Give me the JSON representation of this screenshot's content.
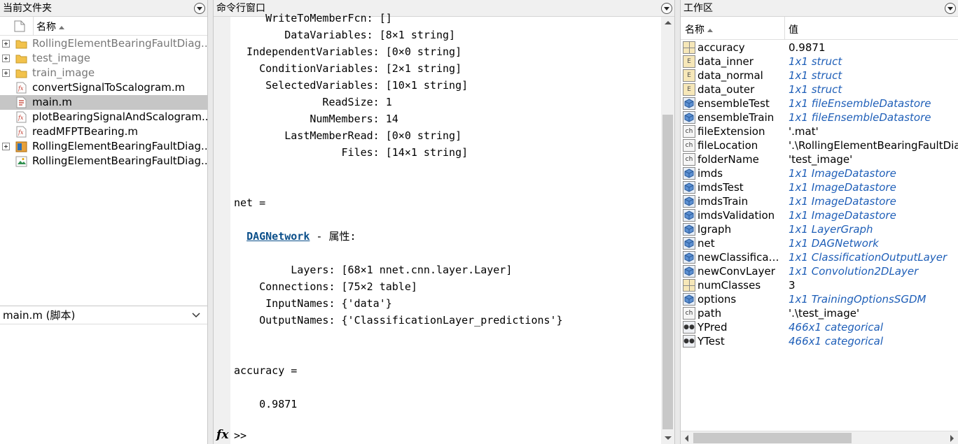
{
  "current_folder": {
    "title": "当前文件夹",
    "col_name": "名称",
    "items": [
      {
        "name": "RollingElementBearingFaultDiag...",
        "type": "folder",
        "expandable": true,
        "gray": true
      },
      {
        "name": "test_image",
        "type": "folder",
        "expandable": true,
        "gray": true
      },
      {
        "name": "train_image",
        "type": "folder",
        "expandable": true,
        "gray": true
      },
      {
        "name": "convertSignalToScalogram.m",
        "type": "function"
      },
      {
        "name": "main.m",
        "type": "script",
        "selected": true
      },
      {
        "name": "plotBearingSignalAndScalogram....",
        "type": "function"
      },
      {
        "name": "readMFPTBearing.m",
        "type": "function"
      },
      {
        "name": "RollingElementBearingFaultDiag...",
        "type": "package",
        "expandable": true
      },
      {
        "name": "RollingElementBearingFaultDiag...",
        "type": "image"
      }
    ]
  },
  "details": {
    "title": "main.m  (脚本)"
  },
  "command_window": {
    "title": "命令行窗口",
    "lines": [
      "     WriteToMemberFcn: []",
      "        DataVariables: [8×1 string]",
      "  IndependentVariables: [0×0 string]",
      "    ConditionVariables: [2×1 string]",
      "     SelectedVariables: [10×1 string]",
      "              ReadSize: 1",
      "            NumMembers: 14",
      "        LastMemberRead: [0×0 string]",
      "                 Files: [14×1 string]",
      "",
      "",
      "net =",
      "",
      "  DAGNETWORK_LINE",
      "",
      "         Layers: [68×1 nnet.cnn.layer.Layer]",
      "    Connections: [75×2 table]",
      "     InputNames: {'data'}",
      "    OutputNames: {'ClassificationLayer_predictions'}",
      "",
      "",
      "accuracy =",
      "",
      "    0.9871"
    ],
    "dagnetwork_link": "DAGNetwork",
    "dagnetwork_suffix": " - 属性:",
    "fx_label": "fx",
    "prompt": ">>"
  },
  "workspace": {
    "title": "工作区",
    "col_name": "名称",
    "col_value": "值",
    "rows": [
      {
        "name": "accuracy",
        "value": "0.9871",
        "kind": "num",
        "obj": false
      },
      {
        "name": "data_inner",
        "value": "1x1 struct",
        "kind": "struct",
        "obj": true
      },
      {
        "name": "data_normal",
        "value": "1x1 struct",
        "kind": "struct",
        "obj": true
      },
      {
        "name": "data_outer",
        "value": "1x1 struct",
        "kind": "struct",
        "obj": true
      },
      {
        "name": "ensembleTest",
        "value": "1x1 fileEnsembleDatastore",
        "kind": "obj",
        "obj": true
      },
      {
        "name": "ensembleTrain",
        "value": "1x1 fileEnsembleDatastore",
        "kind": "obj",
        "obj": true
      },
      {
        "name": "fileExtension",
        "value": "'.mat'",
        "kind": "char",
        "obj": false
      },
      {
        "name": "fileLocation",
        "value": "'.\\RollingElementBearingFaultDiag",
        "kind": "char",
        "obj": false
      },
      {
        "name": "folderName",
        "value": "'test_image'",
        "kind": "char",
        "obj": false
      },
      {
        "name": "imds",
        "value": "1x1 ImageDatastore",
        "kind": "obj",
        "obj": true
      },
      {
        "name": "imdsTest",
        "value": "1x1 ImageDatastore",
        "kind": "obj",
        "obj": true
      },
      {
        "name": "imdsTrain",
        "value": "1x1 ImageDatastore",
        "kind": "obj",
        "obj": true
      },
      {
        "name": "imdsValidation",
        "value": "1x1 ImageDatastore",
        "kind": "obj",
        "obj": true
      },
      {
        "name": "lgraph",
        "value": "1x1 LayerGraph",
        "kind": "obj",
        "obj": true
      },
      {
        "name": "net",
        "value": "1x1 DAGNetwork",
        "kind": "obj",
        "obj": true
      },
      {
        "name": "newClassificati...",
        "value": "1x1 ClassificationOutputLayer",
        "kind": "obj",
        "obj": true
      },
      {
        "name": "newConvLayer",
        "value": "1x1 Convolution2DLayer",
        "kind": "obj",
        "obj": true
      },
      {
        "name": "numClasses",
        "value": "3",
        "kind": "num",
        "obj": false
      },
      {
        "name": "options",
        "value": "1x1 TrainingOptionsSGDM",
        "kind": "obj",
        "obj": true
      },
      {
        "name": "path",
        "value": "'.\\test_image'",
        "kind": "char",
        "obj": false
      },
      {
        "name": "YPred",
        "value": "466x1 categorical",
        "kind": "cat",
        "obj": true
      },
      {
        "name": "YTest",
        "value": "466x1 categorical",
        "kind": "cat",
        "obj": true
      }
    ]
  }
}
